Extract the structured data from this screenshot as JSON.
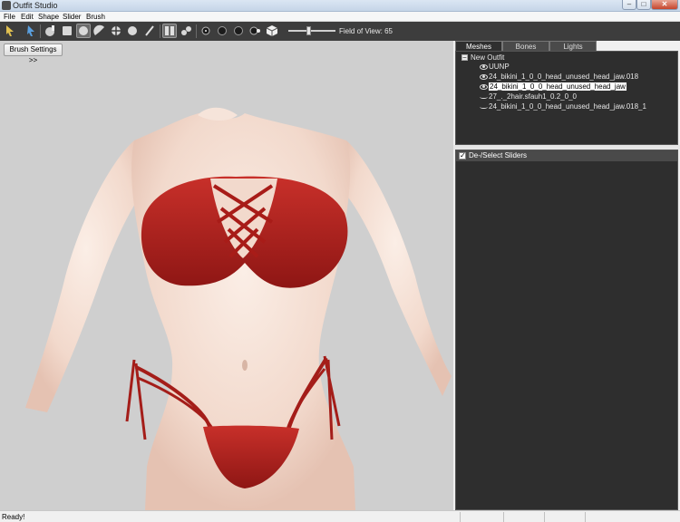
{
  "window": {
    "title": "Outfit Studio"
  },
  "menu": [
    "File",
    "Edit",
    "Shape",
    "Slider",
    "Brush"
  ],
  "toolbar": {
    "tools": [
      "select-tool",
      "transform-tool",
      "standard-brush",
      "mask-brush",
      "inflate-brush",
      "deflate-brush",
      "move-brush",
      "smooth-brush",
      "weight-brush",
      "color-brush",
      "toggle-view",
      "vertex-view",
      "brush-small",
      "brush-medium",
      "brush-large",
      "brush-xlarge",
      "brush-cube"
    ],
    "fov_label": "Field of View: 65",
    "fov_value": 65
  },
  "viewport": {
    "brush_settings_label": "Brush Settings >>"
  },
  "tabs": [
    "Meshes",
    "Bones",
    "Lights"
  ],
  "meshes": {
    "root": "New Outfit",
    "items": [
      {
        "label": "UUNP",
        "visible": true,
        "selected": false
      },
      {
        "label": "24_bikini_1_0_0_head_unused_head_jaw.018",
        "visible": true,
        "selected": false
      },
      {
        "label": "24_bikini_1_0_0_head_unused_head_jaw",
        "visible": true,
        "selected": true
      },
      {
        "label": "27_._2hair.sfauh1_0.2_0_0",
        "visible": false,
        "selected": false
      },
      {
        "label": "24_bikini_1_0_0_head_unused_head_jaw.018_1",
        "visible": false,
        "selected": false
      }
    ]
  },
  "sliders": {
    "header": "De-/Select Sliders",
    "checked": true
  },
  "status": {
    "text": "Ready!"
  },
  "colors": {
    "bikini": "#b0201c",
    "skin": "#f3ded3",
    "viewport_bg": "#cfcfcf",
    "panel_dark": "#2e2e2e"
  }
}
